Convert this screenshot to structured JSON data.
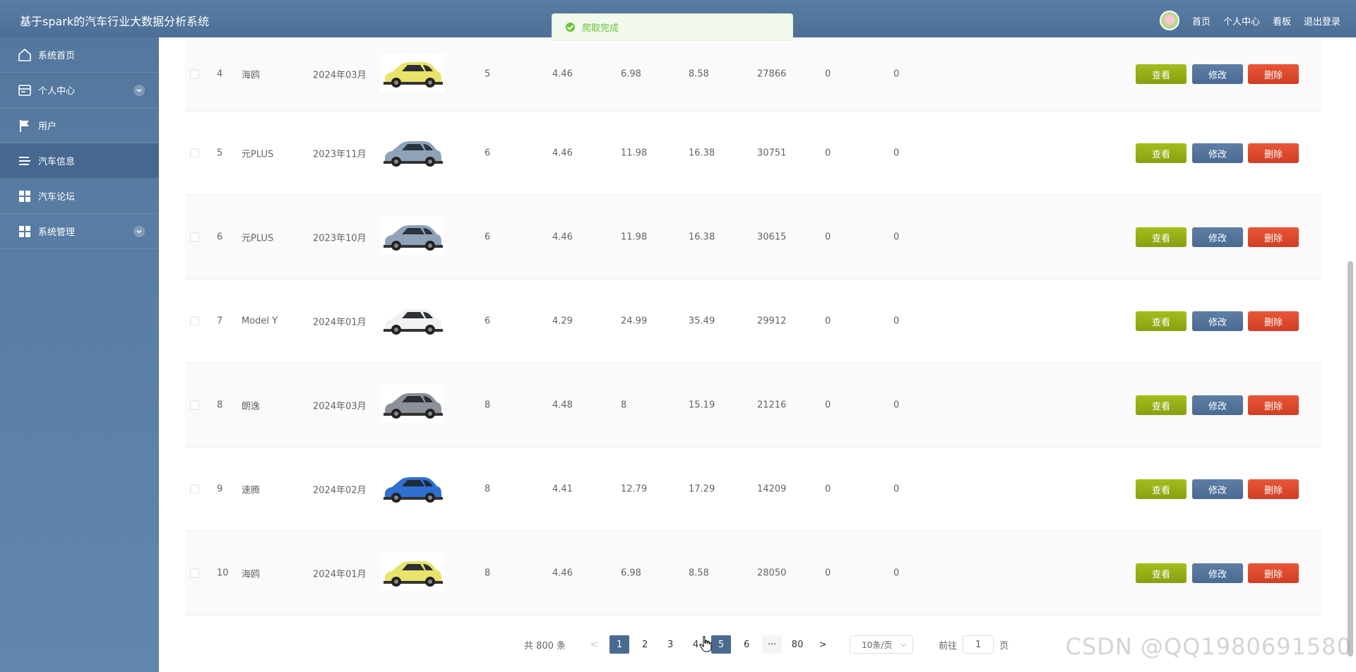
{
  "header": {
    "title": "基于spark的汽车行业大数据分析系统",
    "nav": [
      "首页",
      "个人中心",
      "看板",
      "退出登录"
    ]
  },
  "toast": {
    "text": "爬取完成"
  },
  "sidebar": {
    "items": [
      {
        "label": "系统首页",
        "icon": "home-icon"
      },
      {
        "label": "个人中心",
        "icon": "id-card-icon"
      },
      {
        "label": "用户",
        "icon": "flag-icon"
      },
      {
        "label": "汽车信息",
        "icon": "list-icon"
      },
      {
        "label": "汽车论坛",
        "icon": "grid-icon"
      },
      {
        "label": "系统管理",
        "icon": "grid-icon"
      }
    ]
  },
  "table": {
    "rows": [
      {
        "idx": "4",
        "name": "海鸥",
        "date": "2024年03月",
        "img": "yellow",
        "c1": "5",
        "c2": "4.46",
        "c3": "6.98",
        "c4": "8.58",
        "c5": "27866",
        "c6": "0",
        "c7": "0"
      },
      {
        "idx": "5",
        "name": "元PLUS",
        "date": "2023年11月",
        "img": "blue-gray",
        "c1": "6",
        "c2": "4.46",
        "c3": "11.98",
        "c4": "16.38",
        "c5": "30751",
        "c6": "0",
        "c7": "0"
      },
      {
        "idx": "6",
        "name": "元PLUS",
        "date": "2023年10月",
        "img": "blue-gray",
        "c1": "6",
        "c2": "4.46",
        "c3": "11.98",
        "c4": "16.38",
        "c5": "30615",
        "c6": "0",
        "c7": "0"
      },
      {
        "idx": "7",
        "name": "Model Y",
        "date": "2024年01月",
        "img": "white",
        "c1": "6",
        "c2": "4.29",
        "c3": "24.99",
        "c4": "35.49",
        "c5": "29912",
        "c6": "0",
        "c7": "0"
      },
      {
        "idx": "8",
        "name": "朗逸",
        "date": "2024年03月",
        "img": "gray",
        "c1": "8",
        "c2": "4.48",
        "c3": "8",
        "c4": "15.19",
        "c5": "21216",
        "c6": "0",
        "c7": "0"
      },
      {
        "idx": "9",
        "name": "速腾",
        "date": "2024年02月",
        "img": "blue",
        "c1": "8",
        "c2": "4.41",
        "c3": "12.79",
        "c4": "17.29",
        "c5": "14209",
        "c6": "0",
        "c7": "0"
      },
      {
        "idx": "10",
        "name": "海鸥",
        "date": "2024年01月",
        "img": "yellow",
        "c1": "8",
        "c2": "4.46",
        "c3": "6.98",
        "c4": "8.58",
        "c5": "28050",
        "c6": "0",
        "c7": "0"
      }
    ],
    "btn_view": "查看",
    "btn_edit": "修改",
    "btn_delete": "删除"
  },
  "pager": {
    "total": "共 800 条",
    "prev": "<",
    "next": ">",
    "pages": [
      "1",
      "2",
      "3",
      "4",
      "5",
      "6",
      "···",
      "80"
    ],
    "active": "1",
    "page_size": "10条/页",
    "goto_label": "前往",
    "goto_value": "1",
    "goto_unit": "页"
  },
  "watermark": "CSDN @QQ1980691580",
  "colors": {
    "header": "#5a7da3",
    "view": "#94ad16",
    "edit": "#52729a",
    "delete": "#dc4a2d",
    "toast_success": "#67c23a"
  }
}
